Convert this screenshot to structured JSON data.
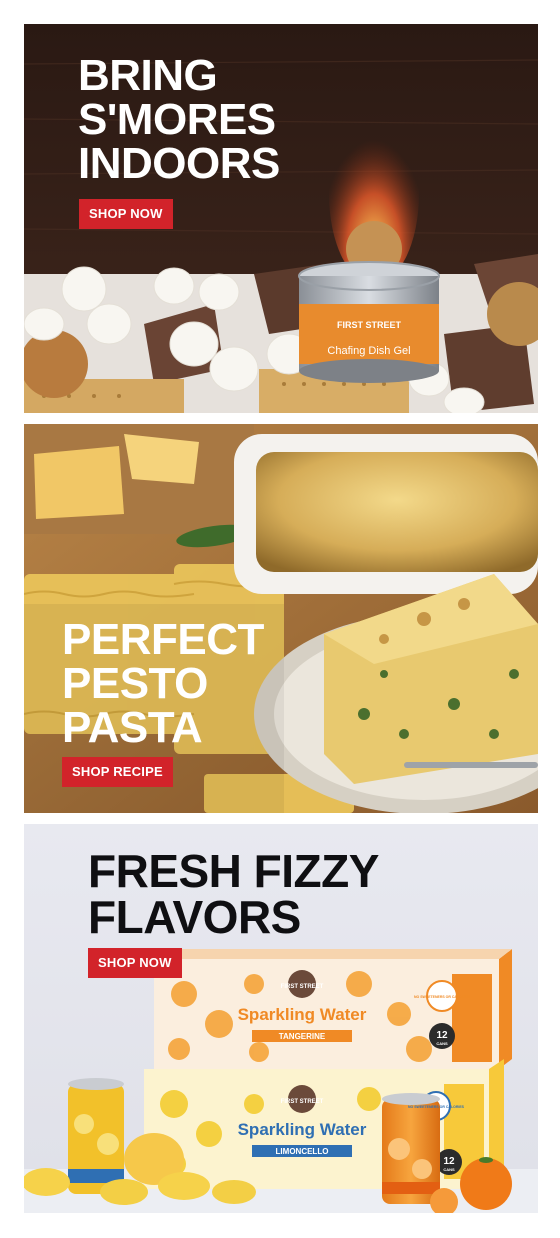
{
  "banners": [
    {
      "headline": "BRING\nS'MORES\nINDOORS",
      "cta_label": "SHOP NOW",
      "can_brand": "FIRST STREET",
      "can_label": "Chafing Dish Gel"
    },
    {
      "headline": "PERFECT\nPESTO\nPASTA",
      "cta_label": "SHOP RECIPE"
    },
    {
      "headline": "FRESH FIZZY\nFLAVORS",
      "cta_label": "SHOP NOW",
      "box_top": {
        "brand": "FIRST STREET",
        "title": "Sparkling Water",
        "flavor": "TANGERINE",
        "badge": "NO SWEETENERS OR CALORIES",
        "count": "12",
        "count_unit": "CANS"
      },
      "box_bottom": {
        "brand": "FIRST STREET",
        "title": "Sparkling Water",
        "flavor": "LIMONCELLO",
        "badge": "NO SWEETENERS OR CALORIES",
        "count": "12",
        "count_unit": "CANS"
      }
    }
  ],
  "colors": {
    "cta_red": "#d2232a",
    "dark_wood": "#2b1a14",
    "tangerine": "#f28a1e",
    "lemon": "#f7d33a",
    "fizzy_bg": "#e6e7ee"
  }
}
